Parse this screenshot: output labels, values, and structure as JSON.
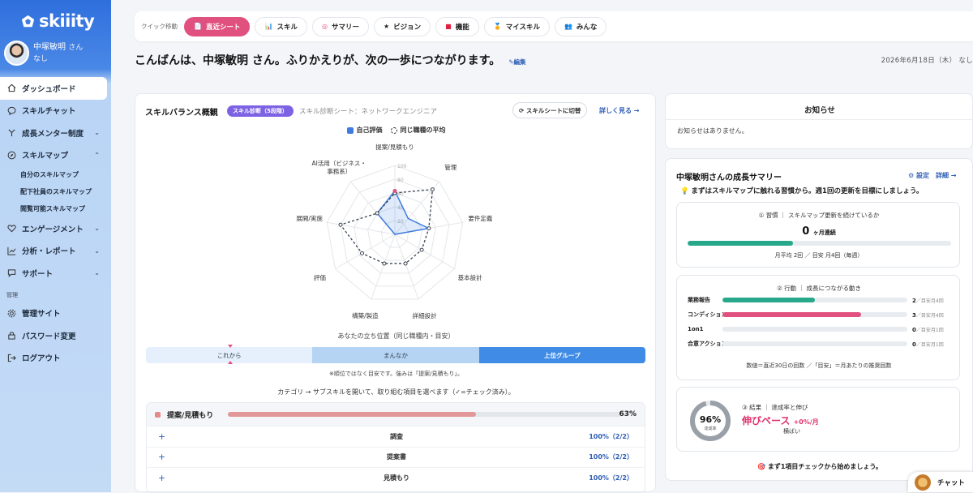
{
  "sidebar": {
    "logo": "skiiity",
    "user_name": "中塚敏明",
    "user_suffix": "さん",
    "user_org": "なし",
    "items": [
      {
        "label": "ダッシュボード"
      },
      {
        "label": "スキルチャット"
      },
      {
        "label": "成長メンター制度"
      },
      {
        "label": "スキルマップ"
      },
      {
        "label": "エンゲージメント"
      },
      {
        "label": "分析・レポート"
      },
      {
        "label": "サポート"
      },
      {
        "label": "管理サイト"
      },
      {
        "label": "パスワード変更"
      },
      {
        "label": "ログアウト"
      }
    ],
    "subitems": [
      "自分のスキルマップ",
      "配下社員のスキルマップ",
      "閲覧可能スキルマップ"
    ],
    "admin_label": "管理"
  },
  "quick": {
    "label": "クイック移動",
    "buttons": [
      "直近シート",
      "スキル",
      "サマリー",
      "ビジョン",
      "機能",
      "マイスキル",
      "みんな"
    ]
  },
  "header": {
    "greeting": "こんばんは、中塚敏明 さん。ふりかえりが、次の一歩につながります。",
    "edit": "✎編集",
    "date": "2026年6月18日（木） なし"
  },
  "skill": {
    "title": "スキルバランス概観",
    "badge": "スキル診断（5段階）",
    "subtitle": "スキル診断シート：ネットワークエンジニア",
    "switch": "⟳ スキルシートに切替",
    "more": "詳しく見る →",
    "legend_self": "自己評価",
    "legend_avg": "同じ職種の平均",
    "position_title": "あなたの立ち位置（同じ職種内・目安）",
    "positions": [
      "これから",
      "まんなか",
      "上位グループ"
    ],
    "position_note": "※順位ではなく目安です。強みは「提案/見積もり」。",
    "category_intro": "カテゴリ → サブスキルを開いて、取り組む項目を選べます（✓=チェック済み）。",
    "category": {
      "name": "提案/見積もり",
      "pct": "63%",
      "fill": 63
    },
    "subskills": [
      {
        "name": "調査",
        "pct": "100%（2/2）"
      },
      {
        "name": "提案書",
        "pct": "100%（2/2）"
      },
      {
        "name": "見積もり",
        "pct": "100%（2/2）"
      }
    ]
  },
  "chart_data": {
    "type": "radar",
    "range": [
      0,
      100
    ],
    "ticks": [
      "20",
      "40",
      "60",
      "80",
      "100"
    ],
    "axes": [
      "提案/見積もり",
      "管理",
      "要件定義",
      "基本設計",
      "詳細設計",
      "構築/製造",
      "評価",
      "展開/実施",
      "AI活用（ビジネス・事務系）"
    ],
    "series": [
      {
        "name": "自己評価",
        "values": [
          63,
          30,
          50,
          0,
          0,
          0,
          0,
          0,
          40
        ]
      },
      {
        "name": "同じ職種の平均",
        "values": [
          60,
          85,
          50,
          45,
          45,
          45,
          55,
          80,
          40
        ]
      }
    ]
  },
  "notice": {
    "title": "お知らせ",
    "body": "お知らせはありません。"
  },
  "growth": {
    "title": "中塚敏明さんの成長サマリー",
    "links": "⚙ 設定　詳細 →",
    "tip": "💡 まずはスキルマップに触れる習慣から。週1回の更新を目標にしましょう。",
    "habit_head": "① 習慣 ｜ スキルマップ更新を続けているか",
    "streak": "0",
    "streak_unit": "ヶ月連続",
    "habit_fill": 40,
    "habit_foot": "月平均 2回 ／ 目安 月4回（毎週）",
    "action_head": "② 行動 ｜ 成長につながる動き",
    "actions": [
      {
        "name": "業務報告",
        "val": "2",
        "target": "／目安月4回",
        "fill": 50,
        "color": "#27a88a"
      },
      {
        "name": "コンディション",
        "val": "3",
        "target": "／目安月4回",
        "fill": 75,
        "color": "#e0517f"
      },
      {
        "name": "1on1",
        "val": "0",
        "target": "／目安月1回",
        "fill": 0,
        "color": "#3f7be0"
      },
      {
        "name": "合意アクション",
        "val": "0",
        "target": "／目安月1回",
        "fill": 0,
        "color": "#3f7be0"
      }
    ],
    "action_foot": "数値＝直近30日の回数 ／「目安」＝月あたりの推奨回数",
    "rate": "96%",
    "rate_label": "達成率",
    "result_head": "③ 結果 ｜ 達成率と伸び",
    "result_big": "伸びペース",
    "result_delta": "+0%/月",
    "result_sub": "横ばい",
    "footer": "🎯 まず1項目チェックから始めましょう。"
  },
  "chat": "チャット"
}
